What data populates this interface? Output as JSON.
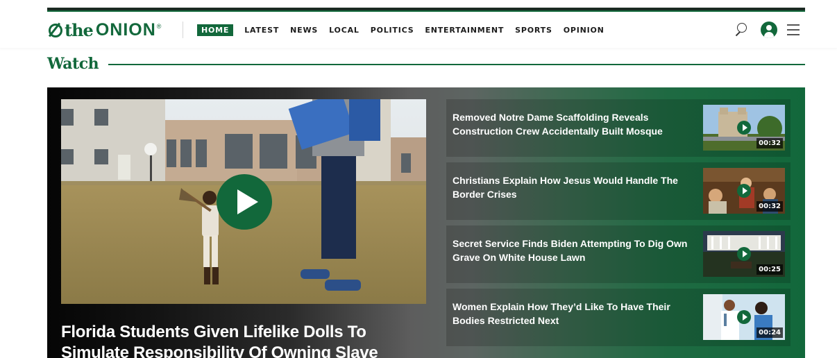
{
  "header": {
    "logo": {
      "the": "the",
      "onion": "ONION",
      "tm": "®"
    },
    "nav": [
      {
        "label": "HOME",
        "active": true
      },
      {
        "label": "LATEST"
      },
      {
        "label": "NEWS"
      },
      {
        "label": "LOCAL"
      },
      {
        "label": "POLITICS"
      },
      {
        "label": "ENTERTAINMENT"
      },
      {
        "label": "SPORTS"
      },
      {
        "label": "OPINION"
      }
    ],
    "icons": [
      "search-icon",
      "user-account-icon",
      "hamburger-menu-icon"
    ]
  },
  "watch": {
    "heading": "Watch",
    "featured": {
      "title": "Florida Students Given Lifelike Dolls To Simulate Responsibility Of Owning Slave",
      "icon": "play-icon"
    },
    "videos": [
      {
        "title": "Removed Notre Dame Scaffolding Reveals Construction Crew Accidentally Built Mosque",
        "duration": "00:32"
      },
      {
        "title": "Christians Explain How Jesus Would Handle The Border Crises",
        "duration": "00:32"
      },
      {
        "title": "Secret Service Finds Biden Attempting To Dig Own Grave On White House Lawn",
        "duration": "00:25"
      },
      {
        "title": "Women Explain How They’d Like To Have Their Bodies Restricted Next",
        "duration": "00:24"
      }
    ]
  },
  "colors": {
    "brand_green": "#12683b",
    "topbar_dark": "#1b2a22",
    "text_dark": "#1b1b1b"
  }
}
